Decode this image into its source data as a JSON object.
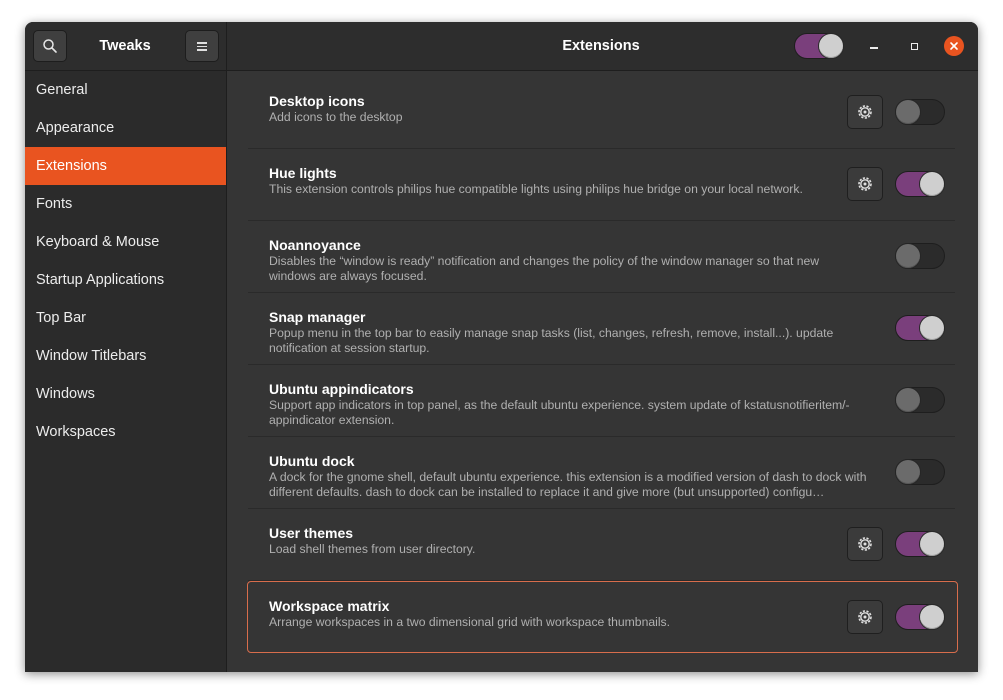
{
  "header": {
    "app_title": "Tweaks",
    "page_title": "Extensions",
    "extensions_enabled": true
  },
  "sidebar": {
    "items": [
      {
        "label": "General"
      },
      {
        "label": "Appearance"
      },
      {
        "label": "Extensions"
      },
      {
        "label": "Fonts"
      },
      {
        "label": "Keyboard & Mouse"
      },
      {
        "label": "Startup Applications"
      },
      {
        "label": "Top Bar"
      },
      {
        "label": "Window Titlebars"
      },
      {
        "label": "Windows"
      },
      {
        "label": "Workspaces"
      }
    ],
    "active_index": 2
  },
  "extensions": [
    {
      "name": "Desktop icons",
      "description": "Add icons to the desktop",
      "has_settings": true,
      "enabled": false
    },
    {
      "name": "Hue lights",
      "description": "This extension controls philips hue compatible lights using philips hue bridge on your local network.",
      "has_settings": true,
      "enabled": true
    },
    {
      "name": "Noannoyance",
      "description": "Disables the “window is ready” notification and changes the policy of the window manager so that new windows are always focused.",
      "has_settings": false,
      "enabled": false
    },
    {
      "name": "Snap manager",
      "description": "Popup menu in the top bar to easily manage snap tasks (list, changes, refresh, remove, install...). update notification at session startup.",
      "has_settings": false,
      "enabled": true
    },
    {
      "name": "Ubuntu appindicators",
      "description": "Support app indicators in top panel, as the default ubuntu experience. system update of kstatusnotifieritem/-appindicator extension.",
      "has_settings": false,
      "enabled": false
    },
    {
      "name": "Ubuntu dock",
      "description": "A dock for the gnome shell, default ubuntu experience. this extension is a modified version of dash to dock with different defaults. dash to dock can be installed to replace it and give more (but unsupported) configu…",
      "has_settings": false,
      "enabled": false
    },
    {
      "name": "User themes",
      "description": "Load shell themes from user directory.",
      "has_settings": true,
      "enabled": true
    },
    {
      "name": "Workspace matrix",
      "description": "Arrange workspaces in a two dimensional grid with workspace thumbnails.",
      "has_settings": true,
      "enabled": true
    }
  ],
  "selected_extension_index": 7,
  "icons": {
    "search": "search-icon",
    "menu": "hamburger-menu-icon",
    "settings": "gear-icon",
    "minimize": "minimize-icon",
    "maximize": "maximize-icon",
    "close": "close-icon"
  },
  "colors": {
    "accent": "#e95420",
    "switch_on": "#7a3f7c",
    "selection_border": "#d86d4c"
  }
}
